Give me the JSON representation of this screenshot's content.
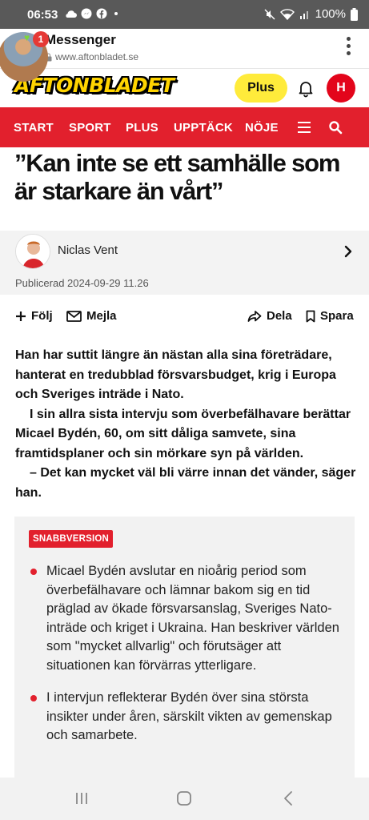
{
  "status_bar": {
    "time": "06:53",
    "battery": "100%",
    "left_icons": [
      "cloud-icon",
      "messenger-icon",
      "facebook-icon",
      "dot-icon"
    ],
    "right_icons": [
      "mute-icon",
      "wifi-icon",
      "signal-icon",
      "battery-icon"
    ]
  },
  "messenger": {
    "title": "Messenger",
    "url": "www.aftonbladet.se",
    "badge_count": "1"
  },
  "site": {
    "logo": "AFTONBLADET",
    "plus_label": "Plus",
    "avatar_letter": "H"
  },
  "nav": {
    "items": [
      "START",
      "SPORT",
      "PLUS",
      "UPPTÄCK",
      "NÖJE"
    ]
  },
  "article": {
    "headline": "”Kan inte se ett samhälle som är starkare än vårt”",
    "author": "Niclas Vent",
    "published": "Publicerad 2024-09-29 11.26",
    "follow_label": "Följ",
    "email_label": "Mejla",
    "share_label": "Dela",
    "save_label": "Spara",
    "lead_paragraphs": [
      "Han har suttit längre än nästan alla sina företrädare, hanterat en tredubblad försvarsbudget, krig i Europa och Sveriges inträde i Nato.",
      "I sin allra sista intervju som överbefälhavare berättar Micael Bydén, 60, om sitt dåliga samvete, sina framtidsplaner och sin mörkare syn på världen.",
      "– Det kan mycket väl bli värre innan det vänder, säger han."
    ]
  },
  "snabbversion": {
    "tag": "SNABBVERSION",
    "bullets": [
      "Micael Bydén avslutar en nioårig period som överbefälhavare och lämnar bakom sig en tid präglad av ökade försvarsanslag, Sveriges Nato-inträde och kriget i Ukraina. Han beskriver världen som \"mycket allvarlig\" och förutsäger att situationen kan förvärras ytterligare.",
      "I intervjun reflekterar Bydén över sina största insikter under åren, särskilt vikten av gemenskap och samarbete."
    ]
  },
  "colors": {
    "brand_red": "#e2202d",
    "plus_yellow": "#ffeb3b",
    "status_bar": "#595959"
  }
}
